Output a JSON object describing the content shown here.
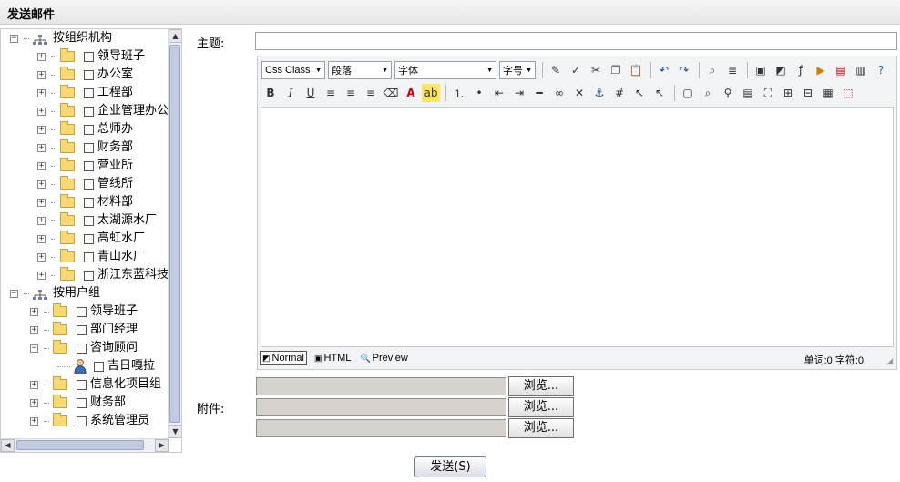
{
  "window": {
    "title": "发送邮件"
  },
  "tree": {
    "groups": [
      {
        "label": "按组织机构",
        "expander": "−",
        "items": [
          {
            "label": "领导班子"
          },
          {
            "label": "办公室"
          },
          {
            "label": "工程部"
          },
          {
            "label": "企业管理办公"
          },
          {
            "label": "总师办"
          },
          {
            "label": "财务部"
          },
          {
            "label": "营业所"
          },
          {
            "label": "管线所"
          },
          {
            "label": "材料部"
          },
          {
            "label": "太湖源水厂"
          },
          {
            "label": "高虹水厂"
          },
          {
            "label": "青山水厂"
          },
          {
            "label": "浙江东蓝科技"
          }
        ]
      },
      {
        "label": "按用户组",
        "expander": "−",
        "items": [
          {
            "label": "领导班子"
          },
          {
            "label": "部门经理"
          },
          {
            "label": "咨询顾问",
            "expanded": true,
            "children": [
              {
                "label": "吉日嘎拉"
              }
            ]
          },
          {
            "label": "信息化项目组"
          },
          {
            "label": "财务部"
          },
          {
            "label": "系统管理员"
          }
        ]
      }
    ],
    "expand_glyph": "+",
    "collapse_glyph": "−"
  },
  "form": {
    "subject_label": "主题:",
    "subject_value": "",
    "attachment_label": "附件:",
    "browse_label": "浏览...",
    "send_label": "发送(S)"
  },
  "editor": {
    "css_class_select": "Css Class",
    "paragraph_select": "段落",
    "font_select": "字体",
    "size_select": "字号",
    "format_buttons": [
      "B",
      "I",
      "U"
    ],
    "modes": [
      {
        "label": "Normal",
        "active": true
      },
      {
        "label": "HTML",
        "active": false
      },
      {
        "label": "Preview",
        "active": false
      }
    ],
    "counts": "单词:0 字符:0"
  },
  "colors": {
    "titlebar_bg": "#ececec",
    "folder": "#f7d872",
    "scroll_thumb": "#c3cbe0"
  }
}
